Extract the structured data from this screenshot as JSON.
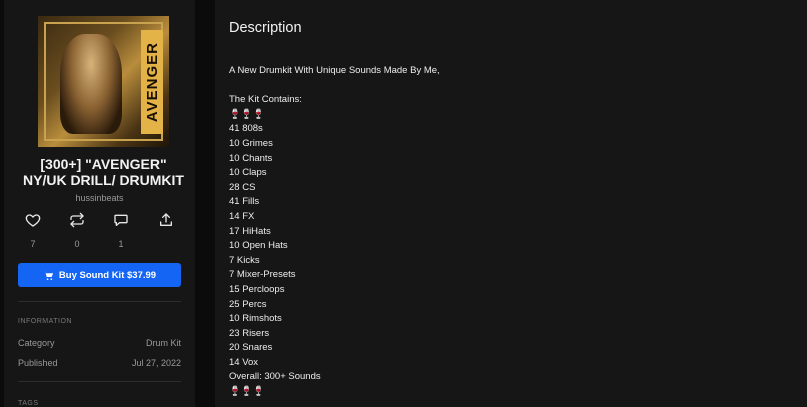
{
  "product": {
    "title": "[300+] \"AVENGER\" NY/UK DRILL/ DRUMKIT",
    "cover_text": "AVENGER",
    "artist": "hussinbeats",
    "stats": {
      "likes": "7",
      "reposts": "0",
      "comments": "1"
    },
    "buy_label": "Buy Sound Kit $37.99"
  },
  "info": {
    "heading": "INFORMATION",
    "rows": [
      {
        "label": "Category",
        "value": "Drum Kit"
      },
      {
        "label": "Published",
        "value": "Jul 27, 2022"
      }
    ],
    "tags_heading": "TAGS"
  },
  "description": {
    "heading": "Description",
    "lines": [
      "A New Drumkit With Unique Sounds Made By Me,",
      "",
      "The Kit Contains:",
      "🍷🍷🍷",
      "41 808s",
      "10 Grimes",
      "10 Chants",
      "10 Claps",
      "28 CS",
      "41 Fills",
      "14 FX",
      "17 HiHats",
      "10 Open Hats",
      "7 Kicks",
      "7 Mixer-Presets",
      "15 Percloops",
      "25 Percs",
      "10 Rimshots",
      "23 Risers",
      "20 Snares",
      "14 Vox",
      "Overall: 300+ Sounds",
      "🍷🍷🍷"
    ]
  },
  "colors": {
    "accent": "#1565f5",
    "panel": "#161616",
    "background": "#0b0b0b"
  }
}
